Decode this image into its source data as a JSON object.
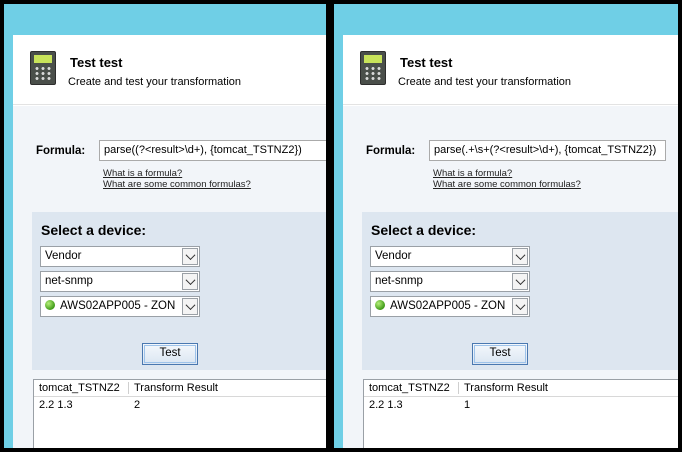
{
  "panels": [
    {
      "header": {
        "title": "Test test",
        "subtitle": "Create and test your transformation"
      },
      "formula": {
        "label": "Formula:",
        "value": "parse((?<result>\\d+), {tomcat_TSTNZ2})",
        "help_link_1": "What is a formula?",
        "help_link_2": "What are some common formulas?"
      },
      "device": {
        "title": "Select a device:",
        "selected_1": "Vendor",
        "selected_2": "net-snmp",
        "selected_3": "AWS02APP005 - ZON",
        "status_color": "#3e9a17"
      },
      "test_label": "Test",
      "results": {
        "col_1": "tomcat_TSTNZ2",
        "col_2": "Transform Result",
        "rows": [
          {
            "c1": "2.2 1.3",
            "c2": "2"
          }
        ]
      }
    },
    {
      "header": {
        "title": "Test test",
        "subtitle": "Create and test your transformation"
      },
      "formula": {
        "label": "Formula:",
        "value": "parse(.+\\s+(?<result>\\d+), {tomcat_TSTNZ2})",
        "help_link_1": "What is a formula?",
        "help_link_2": "What are some common formulas?"
      },
      "device": {
        "title": "Select a device:",
        "selected_1": "Vendor",
        "selected_2": "net-snmp",
        "selected_3": "AWS02APP005 - ZON",
        "status_color": "#3e9a17"
      },
      "test_label": "Test",
      "results": {
        "col_1": "tomcat_TSTNZ2",
        "col_2": "Transform Result",
        "rows": [
          {
            "c1": "2.2 1.3",
            "c2": "1"
          }
        ]
      }
    }
  ],
  "colors": {
    "titlebar": "#6fcfe6",
    "device_box": "#dde6f0",
    "body_bg": "#f2f5f9"
  }
}
